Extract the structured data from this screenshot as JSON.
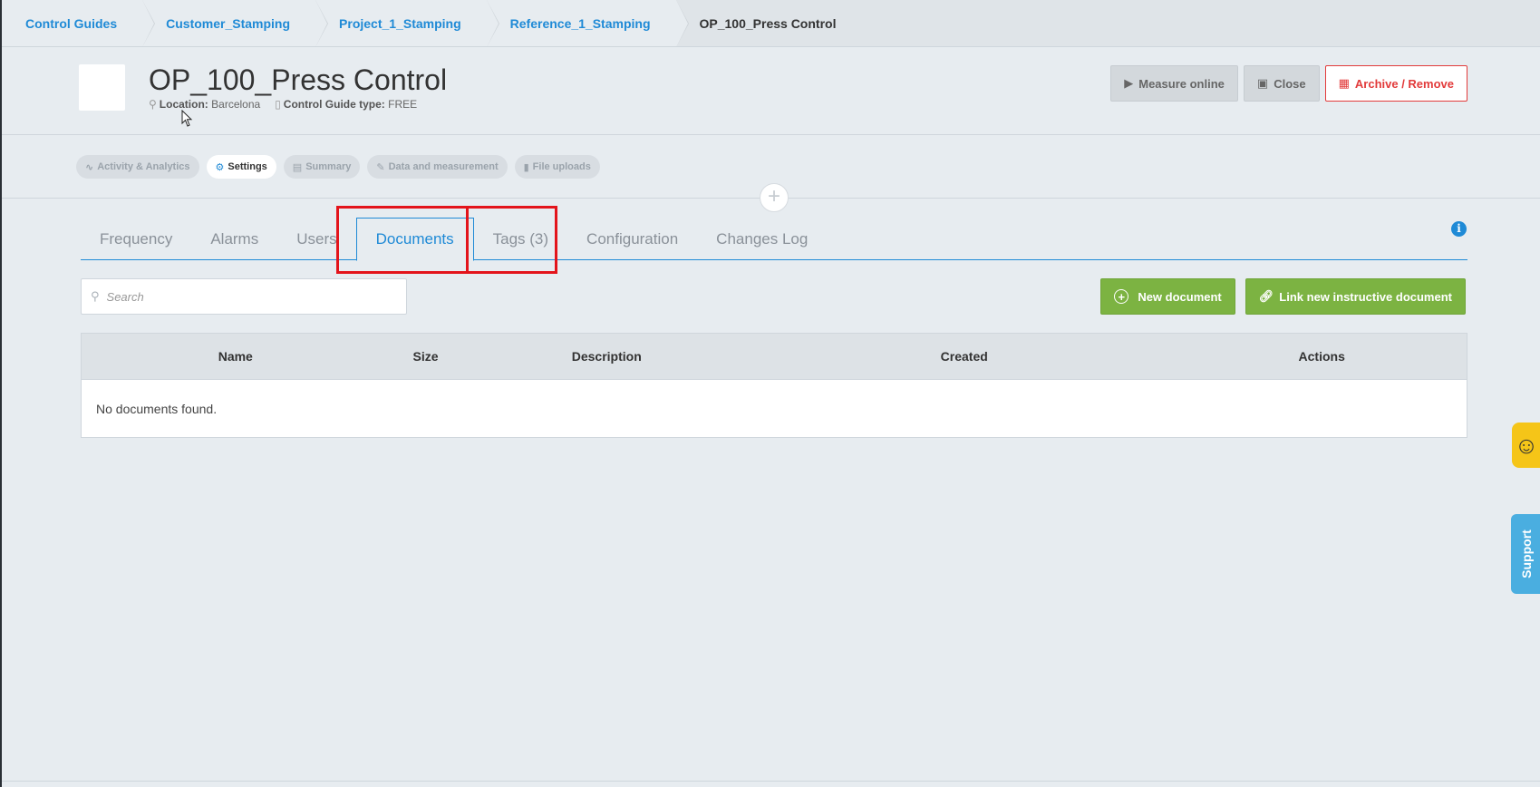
{
  "breadcrumb": {
    "items": [
      "Control Guides",
      "Customer_Stamping",
      "Project_1_Stamping",
      "Reference_1_Stamping"
    ],
    "current": "OP_100_Press Control"
  },
  "header": {
    "title": "OP_100_Press Control",
    "location_label": "Location:",
    "location_value": "Barcelona",
    "type_label": "Control Guide type:",
    "type_value": "FREE",
    "buttons": {
      "measure": "Measure online",
      "close": "Close",
      "archive": "Archive / Remove"
    }
  },
  "subnav": {
    "pills": [
      {
        "label": "Activity & Analytics",
        "icon": "activity-icon"
      },
      {
        "label": "Settings",
        "icon": "gear-icon"
      },
      {
        "label": "Summary",
        "icon": "document-icon"
      },
      {
        "label": "Data and measurement",
        "icon": "pencil-icon"
      },
      {
        "label": "File uploads",
        "icon": "file-icon"
      }
    ],
    "active": "Settings"
  },
  "tabs": {
    "items": [
      "Frequency",
      "Alarms",
      "Users",
      "Documents",
      "Tags (3)",
      "Configuration",
      "Changes Log"
    ],
    "active": "Documents"
  },
  "search": {
    "placeholder": "Search",
    "value": ""
  },
  "actions": {
    "new_document": "New document",
    "link_document": "Link new instructive document"
  },
  "table": {
    "columns": [
      "Name",
      "Size",
      "Description",
      "Created",
      "Actions"
    ],
    "empty_message": "No documents found."
  },
  "widgets": {
    "support": "Support"
  },
  "colors": {
    "accent": "#1f8ad6",
    "green": "#7cb342",
    "danger": "#e23b3b",
    "highlight": "#e3141b"
  }
}
